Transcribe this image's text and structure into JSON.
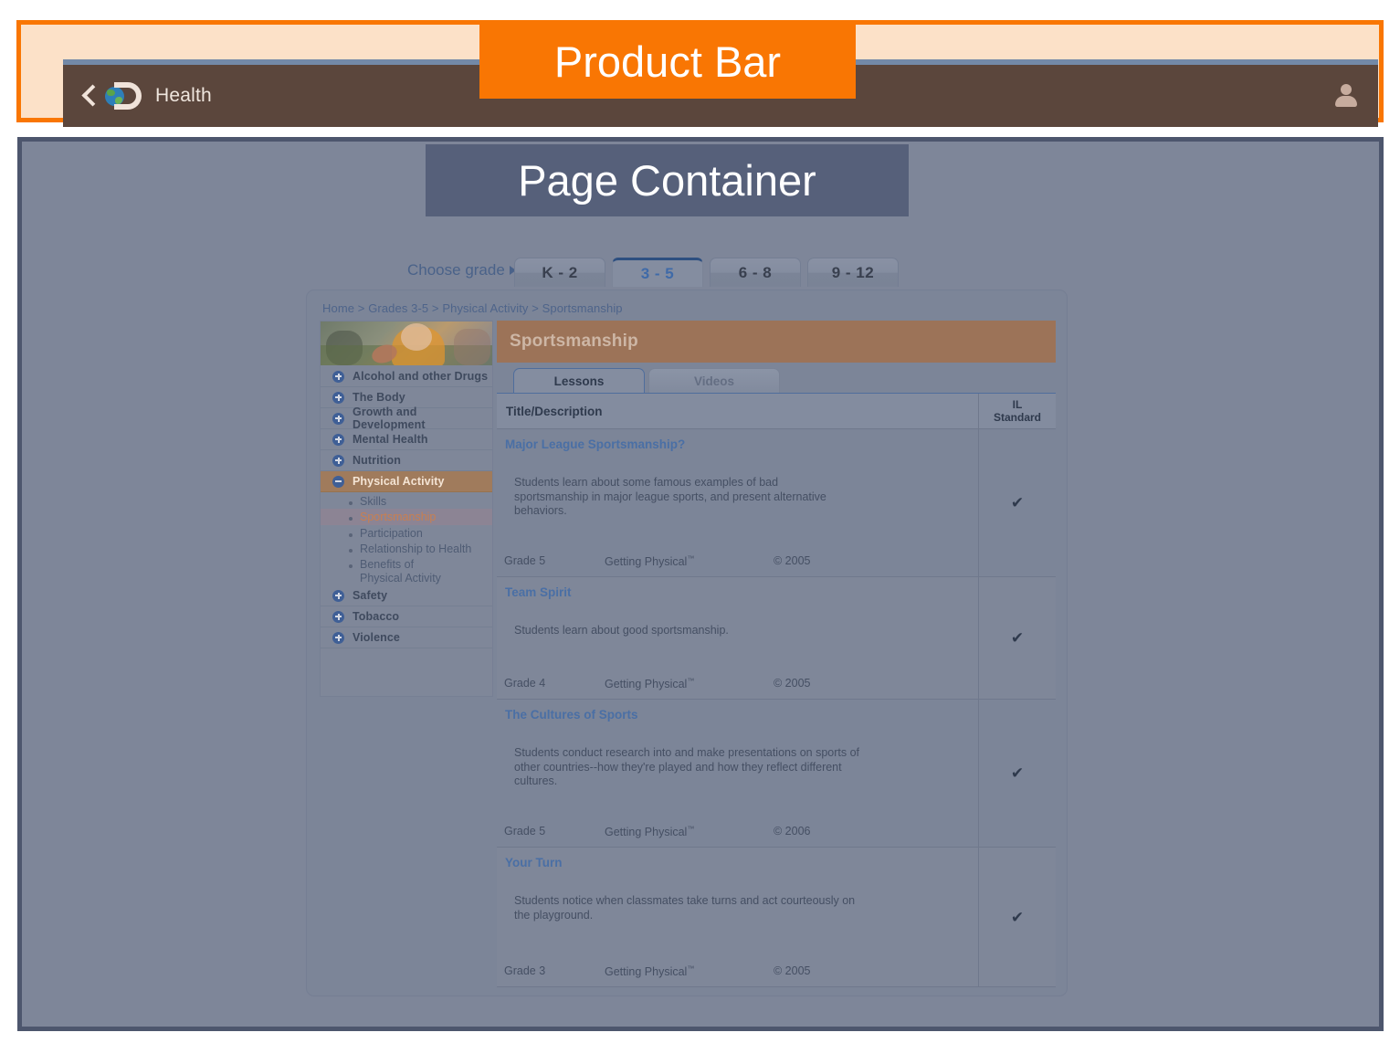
{
  "annotations": {
    "product_bar": "Product Bar",
    "page_container": "Page Container"
  },
  "product_bar": {
    "back_icon": "back-chevron-icon",
    "logo_icon": "discovery-globe-logo-icon",
    "title": "Health",
    "account_icon": "user-account-icon"
  },
  "grade_selector": {
    "label": "Choose grade",
    "caret_icon": "caret-right-icon",
    "tabs": [
      {
        "label": "K - 2",
        "active": false
      },
      {
        "label": "3 - 5",
        "active": true
      },
      {
        "label": "6 - 8",
        "active": false
      },
      {
        "label": "9 - 12",
        "active": false
      }
    ]
  },
  "breadcrumb": "Home > Grades 3-5 > Physical Activity > Sportsmanship",
  "sidebar": {
    "photo_alt": "children-playing-sports-photo",
    "items": [
      {
        "label": "Alcohol and other Drugs",
        "state": "collapsed"
      },
      {
        "label": "The Body",
        "state": "collapsed"
      },
      {
        "label": "Growth and Development",
        "state": "collapsed"
      },
      {
        "label": "Mental Health",
        "state": "collapsed"
      },
      {
        "label": "Nutrition",
        "state": "collapsed"
      },
      {
        "label": "Physical Activity",
        "state": "expanded"
      },
      {
        "label": "Safety",
        "state": "collapsed"
      },
      {
        "label": "Tobacco",
        "state": "collapsed"
      },
      {
        "label": "Violence",
        "state": "collapsed"
      }
    ],
    "sub_items": [
      {
        "label": "Skills",
        "selected": false
      },
      {
        "label": "Sportsmanship",
        "selected": true
      },
      {
        "label": "Participation",
        "selected": false
      },
      {
        "label": "Relationship to Health",
        "selected": false
      },
      {
        "label": "Benefits of Physical Activity",
        "selected": false
      }
    ]
  },
  "content": {
    "topic_title": "Sportsmanship",
    "tabs": [
      {
        "label": "Lessons",
        "active": true
      },
      {
        "label": "Videos",
        "active": false
      }
    ],
    "table": {
      "headers": {
        "title_description": "Title/Description",
        "standard_line1": "IL",
        "standard_line2": "Standard"
      },
      "rows": [
        {
          "title": "Major League Sportsmanship?",
          "description": "Students learn about some famous examples of bad sportsmanship in major league sports, and present alternative behaviors.",
          "grade": "Grade 5",
          "series": "Getting Physical",
          "series_tm": "™",
          "copyright": "© 2005",
          "standard": "✔"
        },
        {
          "title": "Team Spirit",
          "description": "Students learn about good sportsmanship.",
          "grade": "Grade 4",
          "series": "Getting Physical",
          "series_tm": "™",
          "copyright": "© 2005",
          "standard": "✔"
        },
        {
          "title": "The Cultures of Sports",
          "description": "Students conduct research into and make presentations on sports of other countries--how they're played and how they reflect different cultures.",
          "grade": "Grade 5",
          "series": "Getting Physical",
          "series_tm": "™",
          "copyright": "© 2006",
          "standard": "✔"
        },
        {
          "title": "Your Turn",
          "description": "Students notice when classmates take turns and act courteously on the playground.",
          "grade": "Grade 3",
          "series": "Getting Physical",
          "series_tm": "™",
          "copyright": "© 2005",
          "standard": "✔"
        }
      ]
    }
  },
  "colors": {
    "annotation_orange": "#f97603",
    "annotation_slate": "#56607a",
    "product_bar_brown": "#5b463c",
    "topic_banner_brown": "#9c7358",
    "expanded_nav_tan": "#a07b5c",
    "selected_sub_orange": "#c97f50",
    "link_blue": "#4a6fa5",
    "page_container_border": "#4d566d",
    "page_container_fill": "#7e8699"
  }
}
